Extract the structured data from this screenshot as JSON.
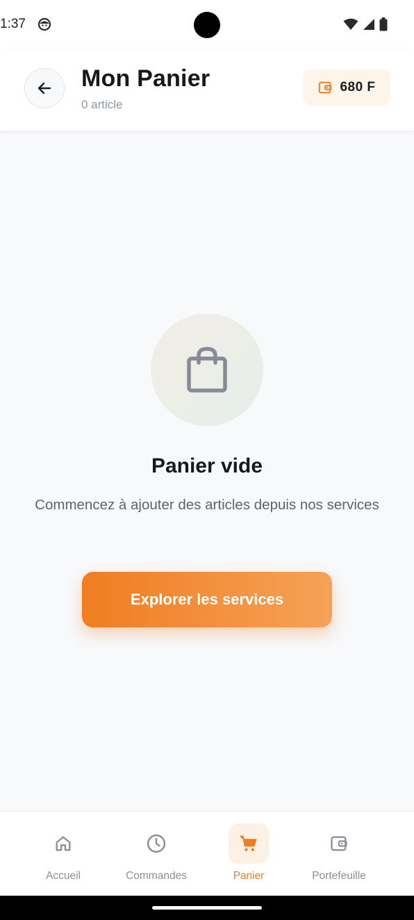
{
  "status_bar": {
    "time": "1:37"
  },
  "header": {
    "title": "Mon Panier",
    "subtitle": "0 article",
    "wallet_amount": "680 F",
    "icons": {
      "back": "arrow-left-icon",
      "wallet": "wallet-icon"
    }
  },
  "empty_state": {
    "icon": "shopping-bag-icon",
    "title": "Panier vide",
    "description": "Commencez à ajouter des articles depuis nos services",
    "button_label": "Explorer les services"
  },
  "bottom_nav": {
    "items": [
      {
        "label": "Accueil",
        "icon": "home-icon",
        "active": false
      },
      {
        "label": "Commandes",
        "icon": "clock-icon",
        "active": false
      },
      {
        "label": "Panier",
        "icon": "cart-icon",
        "active": true
      },
      {
        "label": "Portefeuille",
        "icon": "wallet-icon",
        "active": false
      }
    ]
  },
  "colors": {
    "accent": "#f07d21",
    "background": "#f8f9fb",
    "text_primary": "#17181c",
    "text_secondary": "#5e636c",
    "nav_inactive": "#8a9099"
  }
}
